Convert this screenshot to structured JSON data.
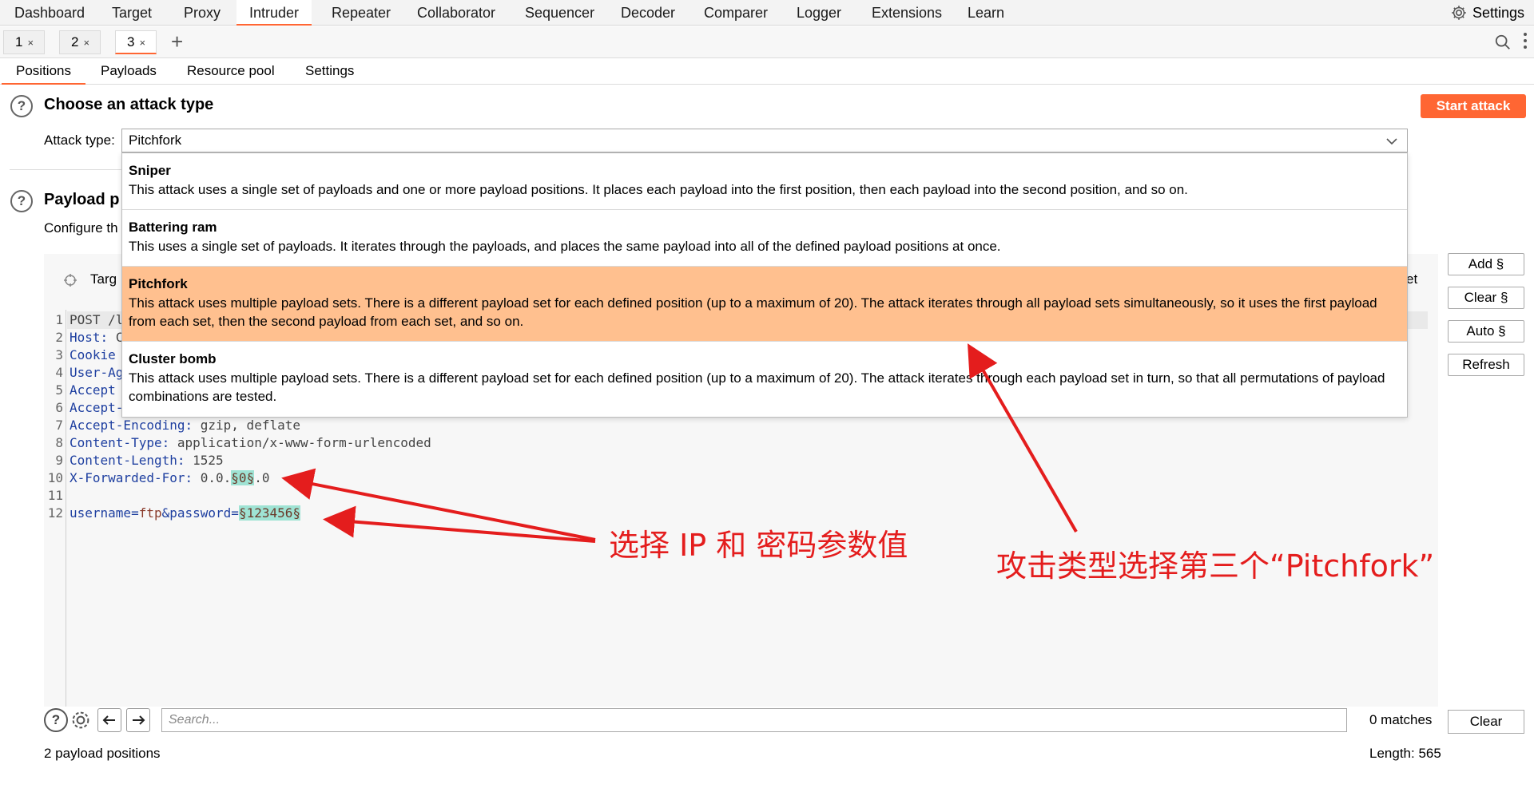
{
  "menu": {
    "items": [
      "Dashboard",
      "Target",
      "Proxy",
      "Intruder",
      "Repeater",
      "Collaborator",
      "Sequencer",
      "Decoder",
      "Comparer",
      "Logger",
      "Extensions",
      "Learn"
    ],
    "settings": "Settings"
  },
  "tabs": [
    {
      "label": "1",
      "close": "×"
    },
    {
      "label": "2",
      "close": "×"
    },
    {
      "label": "3",
      "close": "×"
    }
  ],
  "subtabs": [
    "Positions",
    "Payloads",
    "Resource pool",
    "Settings"
  ],
  "attack": {
    "heading": "Choose an attack type",
    "type_label": "Attack type:",
    "selected": "Pitchfork",
    "start_button": "Start attack",
    "options": [
      {
        "title": "Sniper",
        "desc": "This attack uses a single set of payloads and one or more payload positions. It places each payload into the first position, then each payload into the second position, and so on."
      },
      {
        "title": "Battering ram",
        "desc": "This uses a single set of payloads. It iterates through the payloads, and places the same payload into all of the defined payload positions at once."
      },
      {
        "title": "Pitchfork",
        "desc": "This attack uses multiple payload sets. There is a different payload set for each defined position (up to a maximum of 20). The attack iterates through all payload sets simultaneously, so it uses the first payload from each set, then the second payload from each set, and so on."
      },
      {
        "title": "Cluster bomb",
        "desc": "This attack uses multiple payload sets. There is a different payload set for each defined position (up to a maximum of 20). The attack iterates through each payload set in turn, so that all permutations of payload combinations are tested."
      }
    ]
  },
  "positions": {
    "heading_partial": "Payload p",
    "configure_partial": "Configure th",
    "target_partial": "Targ",
    "right_partial": "et"
  },
  "request": {
    "lines": [
      {
        "n": "1",
        "k": "",
        "v": "POST /l"
      },
      {
        "n": "2",
        "k": "Host:",
        "v": " C"
      },
      {
        "n": "3",
        "k": "Cookie",
        "v": ""
      },
      {
        "n": "4",
        "k": "User-Ag",
        "v": ""
      },
      {
        "n": "5",
        "k": "Accept",
        "v": ""
      },
      {
        "n": "6",
        "k": "Accept-",
        "v": ""
      },
      {
        "n": "7",
        "k": "Accept-Encoding:",
        "v": " gzip, deflate"
      },
      {
        "n": "8",
        "k": "Content-Type:",
        "v": " application/x-www-form-urlencoded"
      },
      {
        "n": "9",
        "k": "Content-Length:",
        "v": " 1525"
      },
      {
        "n": "10",
        "k": "X-Forwarded-For:",
        "v": " 0.0.",
        "p": "§0§",
        "after": ".0"
      },
      {
        "n": "11",
        "k": "",
        "v": ""
      },
      {
        "n": "12",
        "k": "username=",
        "v": "ftp",
        "k2": "&password=",
        "p": "§123456§"
      }
    ]
  },
  "side_buttons": [
    "Add §",
    "Clear §",
    "Auto §",
    "Refresh"
  ],
  "bottom": {
    "search_placeholder": "Search...",
    "matches": "0 matches",
    "clear": "Clear",
    "payload_positions": "2 payload positions",
    "length": "Length: 565"
  },
  "annotations": {
    "left": "选择 IP 和 密码参数值",
    "right": "攻击类型选择第三个“Pitchfork”"
  },
  "colors": {
    "accent": "#ff6633",
    "selected_option": "#ffc08f",
    "payload_marker": "#9fe3d4",
    "annotation": "#e41d1d"
  }
}
